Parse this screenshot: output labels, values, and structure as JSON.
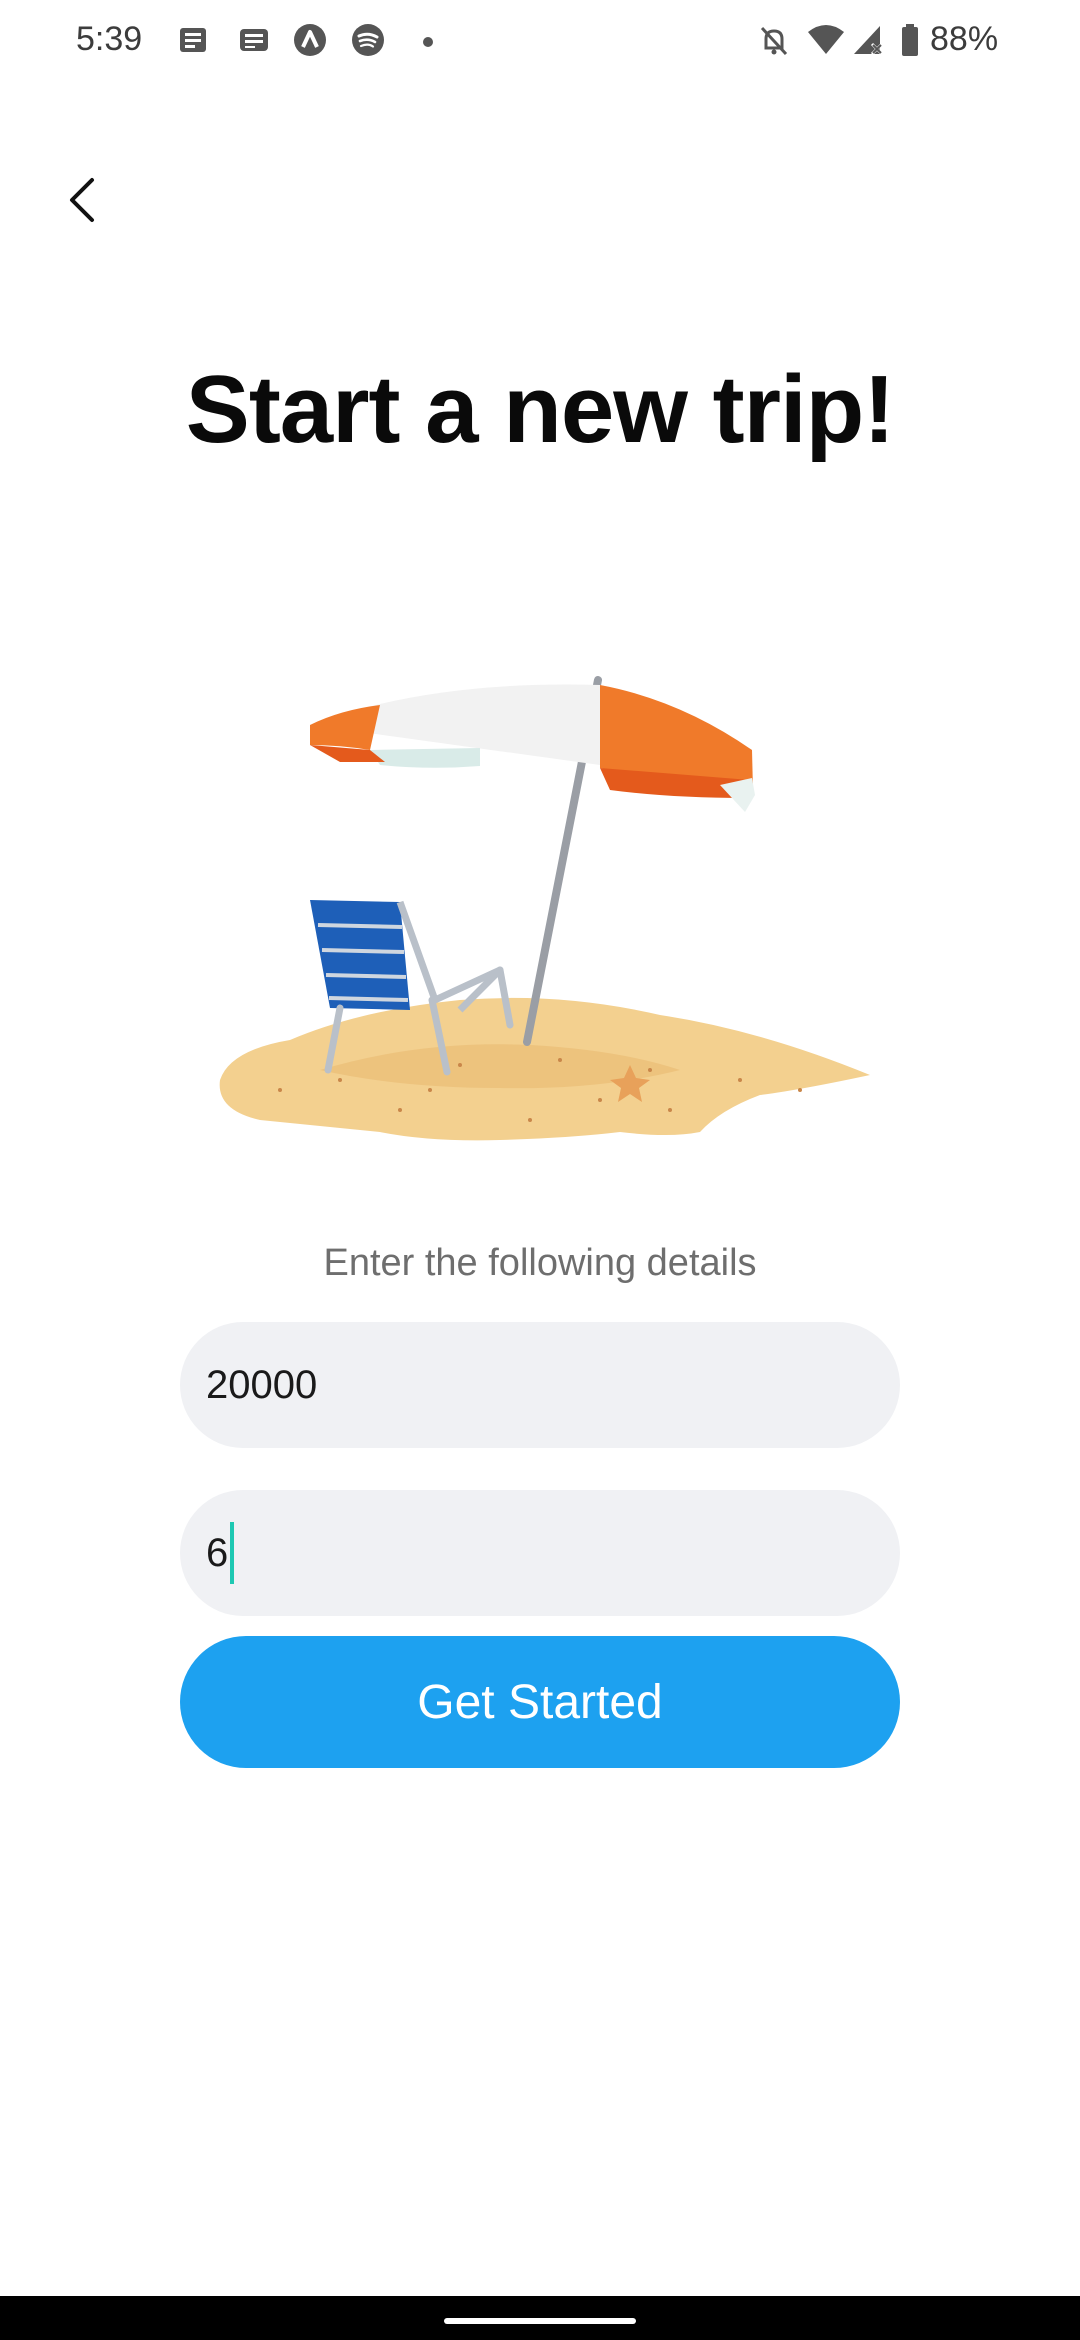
{
  "status_bar": {
    "time": "5:39",
    "notification_icons": [
      "news-icon",
      "reader-icon",
      "arrow-up-circle-icon",
      "spotify-icon",
      "dot-icon"
    ],
    "system_icons": [
      "bell-off-icon",
      "wifi-icon",
      "signal-icon",
      "battery-icon"
    ],
    "battery": "88%"
  },
  "header": {
    "back_icon": "chevron-left-icon"
  },
  "title": "Start a new trip!",
  "illustration": {
    "subject": "beach-umbrella-chair"
  },
  "form": {
    "label": "Enter the following details",
    "field_1_value": "20000",
    "field_2_value": "6",
    "submit_label": "Get Started"
  },
  "colors": {
    "accent": "#1da1f0",
    "field_bg": "#f0f1f4",
    "caret": "#1ec8b2"
  }
}
